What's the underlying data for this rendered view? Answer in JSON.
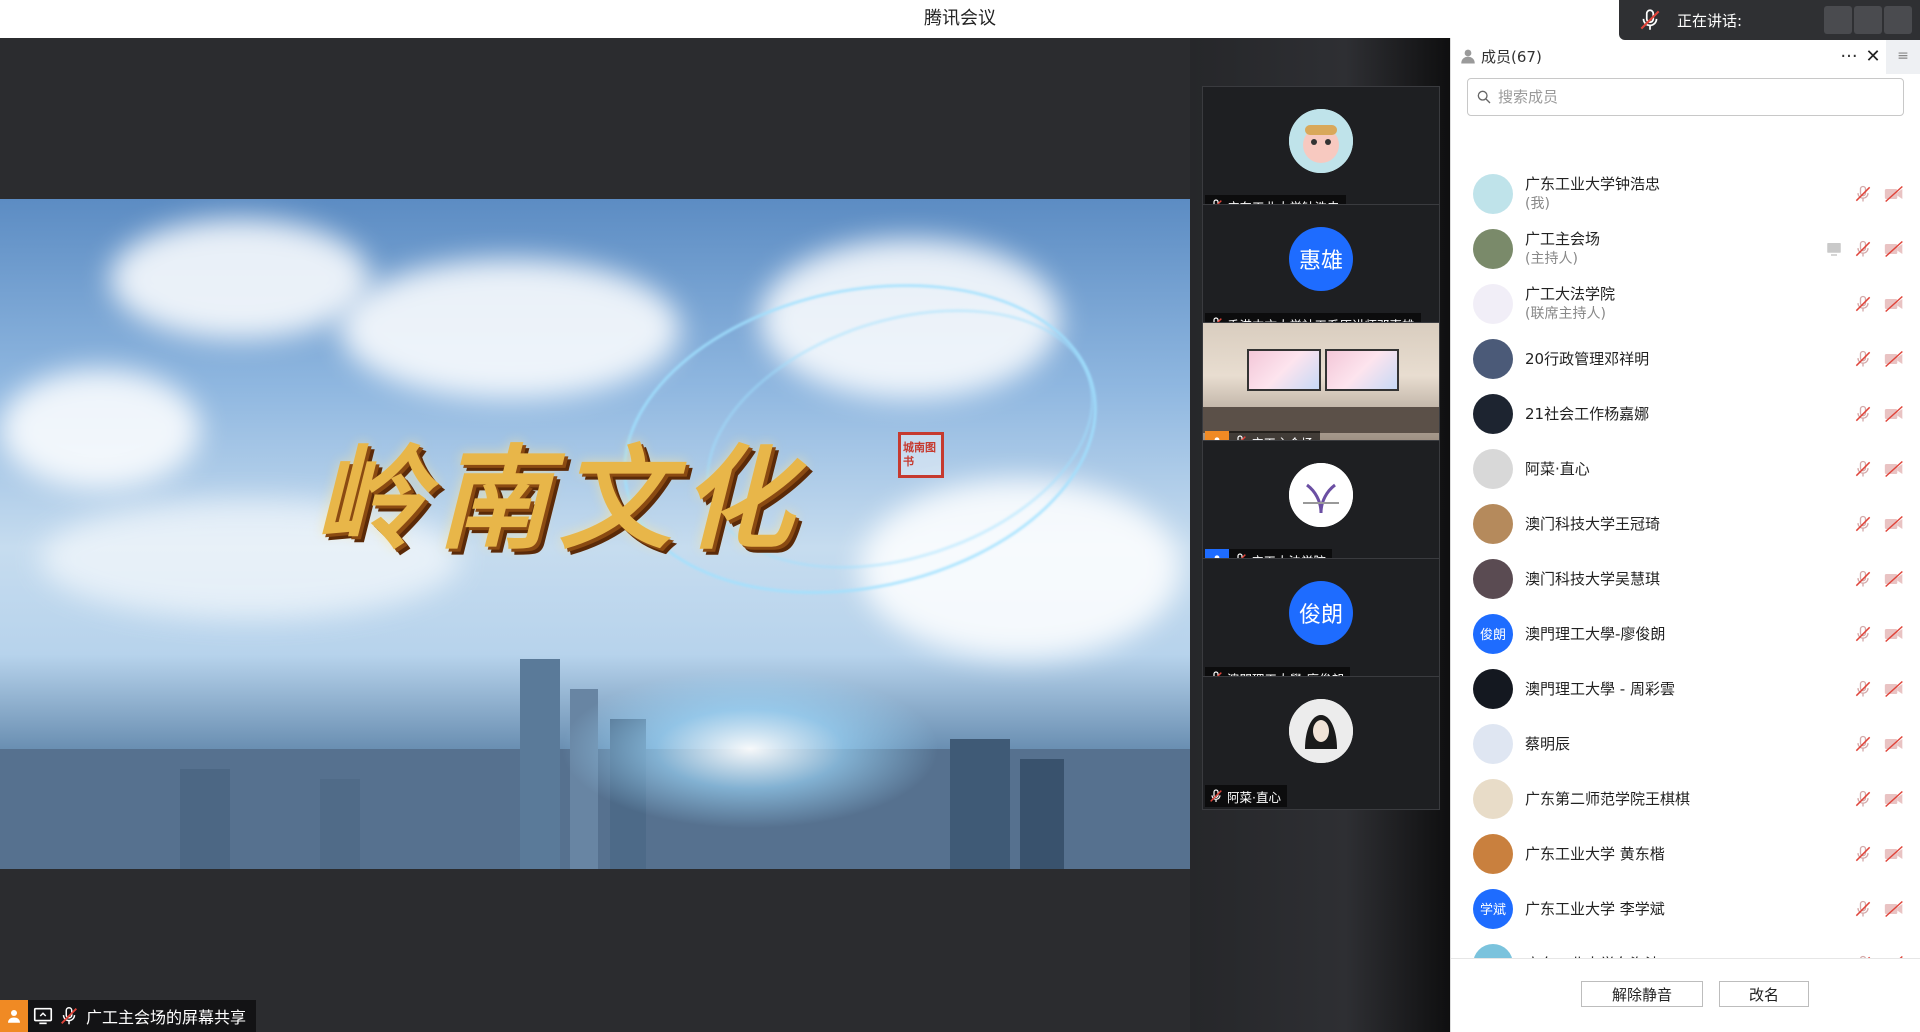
{
  "app": {
    "title": "腾讯会议"
  },
  "speaking": {
    "label": "正在讲话:"
  },
  "share": {
    "art_title": "岭南文化",
    "seal_text": "城南图书",
    "label": "广工主会场的屏幕共享"
  },
  "tiles": [
    {
      "name": "广东工业大学钟浩忠",
      "avatar_type": "image",
      "role": "none",
      "avatar_color": "#bfe3ea"
    },
    {
      "name": "香港中文大学社工系原讲师邓惠雄",
      "avatar_type": "text",
      "avatar_text": "惠雄",
      "role": "none",
      "avatar_color": "#1e6cff"
    },
    {
      "name": "广工主会场",
      "avatar_type": "room",
      "role": "host",
      "avatar_color": ""
    },
    {
      "name": "广工大法学院",
      "avatar_type": "image",
      "role": "cohost",
      "avatar_color": "#ffffff"
    },
    {
      "name": "澳門理工大學-廖俊朗",
      "avatar_type": "text",
      "avatar_text": "俊朗",
      "role": "none",
      "avatar_color": "#1e6cff"
    },
    {
      "name": "阿菜·直心",
      "avatar_type": "image",
      "role": "none",
      "avatar_color": "#e9e9e9"
    }
  ],
  "panel": {
    "title": "成员(67)",
    "more_icon": "···",
    "close_icon": "✕",
    "menu_icon": "≡",
    "search_placeholder": "搜索成员",
    "members": [
      {
        "name": "广东工业大学钟浩忠",
        "sub": "(我)",
        "avatar_type": "image",
        "avatar_color": "#bfe3ea",
        "share": false
      },
      {
        "name": "广工主会场",
        "sub": "(主持人)",
        "avatar_type": "image",
        "avatar_color": "#7a8a6a",
        "share": true
      },
      {
        "name": "广工大法学院",
        "sub": "(联席主持人)",
        "avatar_type": "image",
        "avatar_color": "#f1eef7",
        "share": false
      },
      {
        "name": "20行政管理邓祥明",
        "sub": "",
        "avatar_type": "image",
        "avatar_color": "#4b5a78",
        "share": false
      },
      {
        "name": "21社会工作杨嘉娜",
        "sub": "",
        "avatar_type": "image",
        "avatar_color": "#1d2430",
        "share": false
      },
      {
        "name": "阿菜·直心",
        "sub": "",
        "avatar_type": "image",
        "avatar_color": "#d8d8d8",
        "share": false
      },
      {
        "name": "澳门科技大学王冠琦",
        "sub": "",
        "avatar_type": "image",
        "avatar_color": "#b58a5c",
        "share": false
      },
      {
        "name": "澳门科技大学吴慧琪",
        "sub": "",
        "avatar_type": "image",
        "avatar_color": "#5a4b52",
        "share": false
      },
      {
        "name": "澳門理工大學-廖俊朗",
        "sub": "",
        "avatar_type": "text",
        "avatar_text": "俊朗",
        "avatar_color": "#1e6cff",
        "share": false
      },
      {
        "name": "澳門理工大學 - 周彩雲",
        "sub": "",
        "avatar_type": "image",
        "avatar_color": "#141820",
        "share": false
      },
      {
        "name": "蔡明辰",
        "sub": "",
        "avatar_type": "image",
        "avatar_color": "#dfe6f2",
        "share": false
      },
      {
        "name": "广东第二师范学院王棋棋",
        "sub": "",
        "avatar_type": "image",
        "avatar_color": "#e8dcc8",
        "share": false
      },
      {
        "name": "广东工业大学 黄东楷",
        "sub": "",
        "avatar_type": "image",
        "avatar_color": "#c9803e",
        "share": false
      },
      {
        "name": "广东工业大学 李学斌",
        "sub": "",
        "avatar_type": "text",
        "avatar_text": "学斌",
        "avatar_color": "#1e6cff",
        "share": false
      },
      {
        "name": "广东工业大学车海波",
        "sub": "",
        "avatar_type": "image",
        "avatar_color": "#7bc3dd",
        "share": false
      }
    ],
    "unmute_label": "解除静音",
    "rename_label": "改名"
  },
  "colors": {
    "accent": "#1e6cff",
    "host_badge": "#f08a24",
    "stage_bg": "#2b2c2f",
    "muted_red": "#e0443a"
  }
}
